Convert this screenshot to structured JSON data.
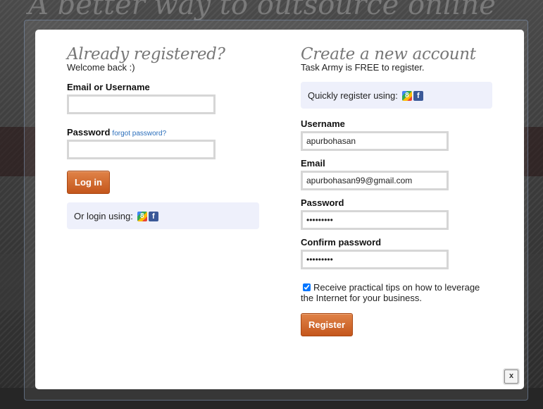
{
  "background": {
    "title": "A better way to outsource online"
  },
  "login": {
    "title": "Already registered?",
    "subtitle": "Welcome back :)",
    "email_label": "Email or Username",
    "email_value": "",
    "password_label": "Password",
    "forgot_link": "forgot password?",
    "password_value": "",
    "login_button": "Log in",
    "social_text": "Or login using:"
  },
  "register": {
    "title": "Create a new account",
    "subtitle": "Task Army is FREE to register.",
    "social_text": "Quickly register using:",
    "username_label": "Username",
    "username_value": "apurbohasan",
    "email_label": "Email",
    "email_value": "apurbohasan99@gmail.com",
    "password_label": "Password",
    "password_value": "•••••••••",
    "confirm_label": "Confirm password",
    "confirm_value": "•••••••••",
    "tips_checkbox_checked": true,
    "tips_text": "Receive practical tips on how to leverage the Internet for your business.",
    "register_button": "Register"
  },
  "close_label": "x",
  "icons": {
    "google": "google-plus-icon",
    "facebook": "facebook-icon"
  },
  "colors": {
    "button": "#c4561c",
    "social_bg": "#eef0fb",
    "link": "#2a6ebb"
  }
}
